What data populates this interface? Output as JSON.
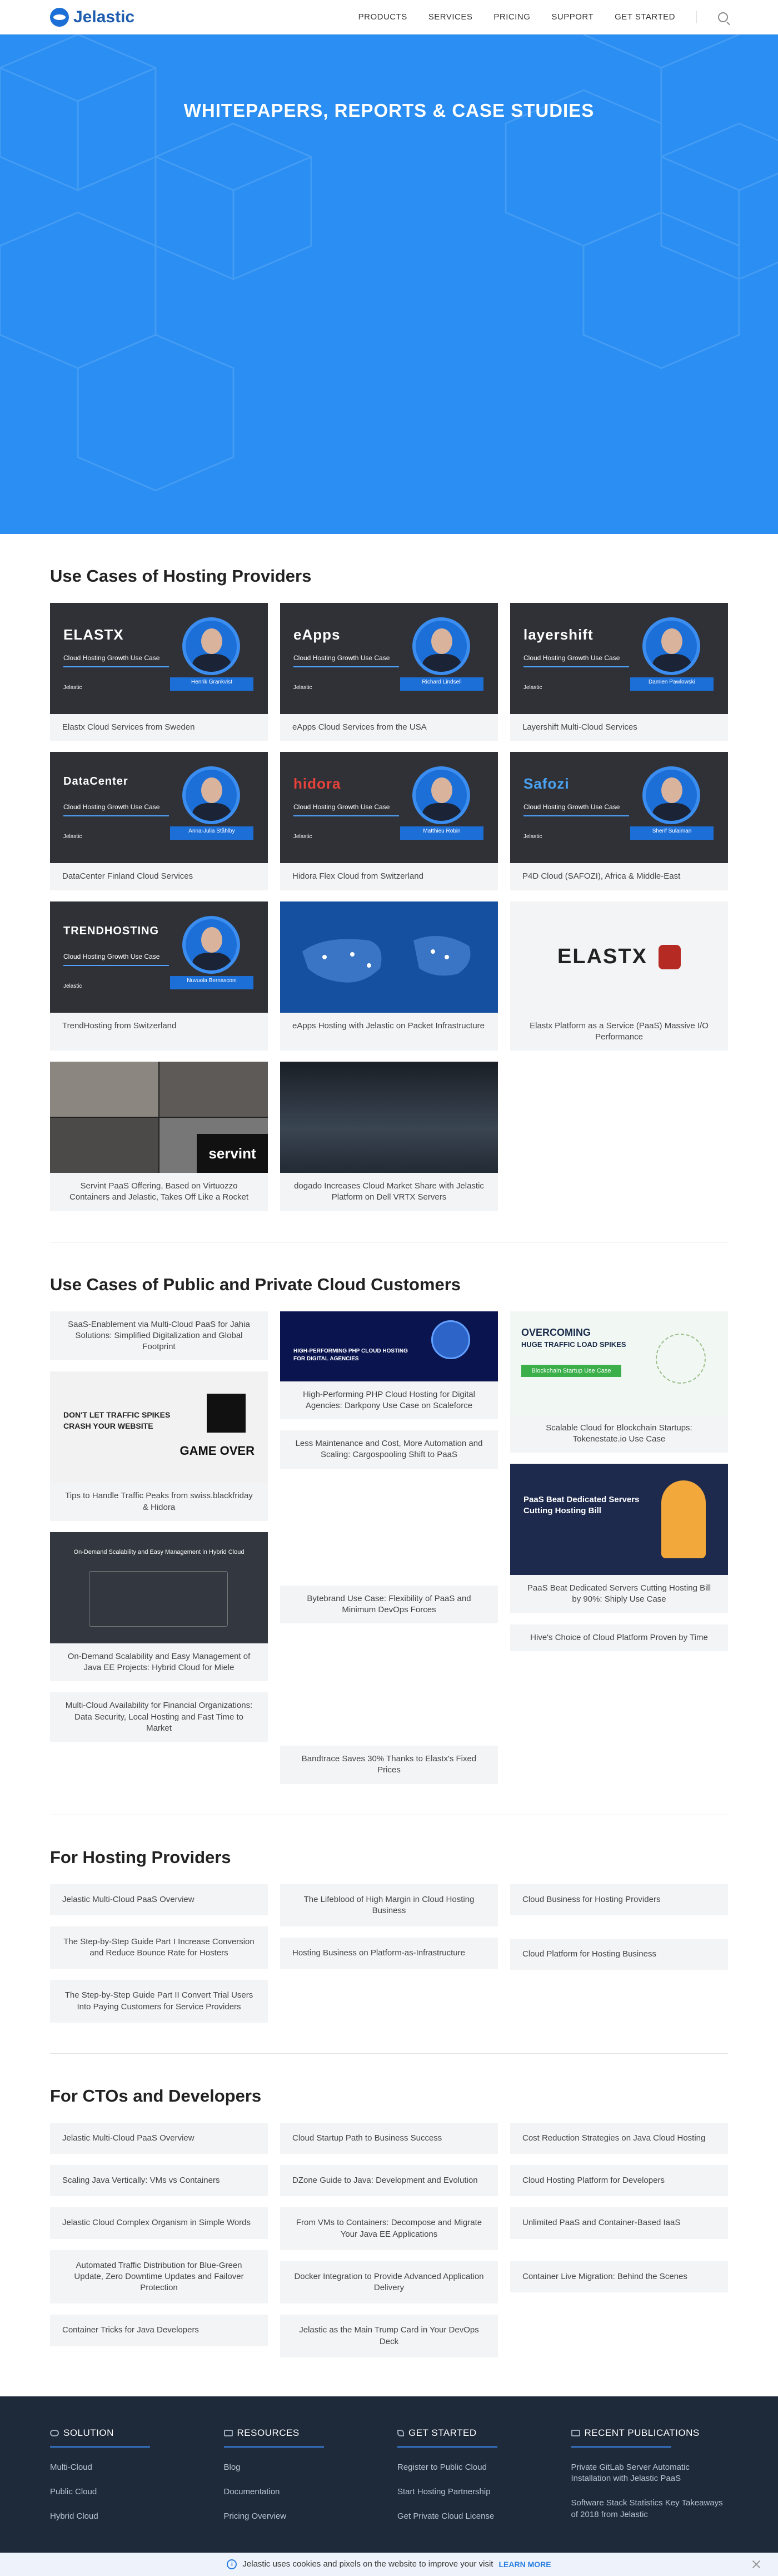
{
  "header": {
    "logo": "Jelastic",
    "nav": [
      "PRODUCTS",
      "SERVICES",
      "PRICING",
      "SUPPORT",
      "GET STARTED"
    ]
  },
  "hero": {
    "title": "WHITEPAPERS, REPORTS & CASE STUDIES"
  },
  "hosting_use_cases": {
    "title": "Use Cases of Hosting Providers",
    "cards": [
      {
        "caption": "Elastx Cloud Services from Sweden",
        "brand": "ELASTX",
        "growth": "Cloud Hosting Growth Use Case",
        "logo": "Jelastic",
        "person": "Henrik Grankvist"
      },
      {
        "caption": "eApps Cloud Services from the USA",
        "brand": "eApps",
        "growth": "Cloud Hosting Growth Use Case",
        "logo": "Jelastic",
        "person": "Richard Lindsell"
      },
      {
        "caption": "Layershift Multi-Cloud Services",
        "brand": "layershift",
        "growth": "Cloud Hosting Growth Use Case",
        "logo": "Jelastic",
        "person": "Damien Pawlowski"
      },
      {
        "caption": "DataCenter Finland Cloud Services",
        "brand": "DataCenter",
        "growth": "Cloud Hosting Growth Use Case",
        "logo": "Jelastic",
        "person": "Anna-Julia Ståhlby"
      },
      {
        "caption": "Hidora Flex Cloud from Switzerland",
        "brand": "hidora",
        "growth": "Cloud Hosting Growth Use Case",
        "logo": "Jelastic",
        "person": "Matthieu Robin"
      },
      {
        "caption": "P4D Cloud (SAFOZI), Africa & Middle-East",
        "brand": "Safozi",
        "growth": "Cloud Hosting Growth Use Case",
        "logo": "Jelastic",
        "person": "Sherif Sulaiman"
      },
      {
        "caption": "TrendHosting from Switzerland",
        "brand": "TRENDHOSTING",
        "growth": "Cloud Hosting Growth Use Case",
        "logo": "Jelastic",
        "person": "Nuvuola Bernasconi"
      },
      {
        "caption": "eApps Hosting with Jelastic on Packet Infrastructure"
      },
      {
        "caption": "Elastx Platform as a Service (PaaS) Massive I/O Performance",
        "brand": "ELASTX"
      },
      {
        "caption": "Servint PaaS Offering, Based on Virtuozzo Containers and Jelastic, Takes Off Like a Rocket",
        "brand": "servint"
      },
      {
        "caption": "dogado Increases Cloud Market Share with Jelastic Platform on Dell VRTX Servers"
      }
    ]
  },
  "cloud_use_cases": {
    "title": "Use Cases of Public and Private Cloud Customers",
    "col1": [
      {
        "caption": "SaaS-Enablement via Multi-Cloud PaaS for Jahia Solutions: Simplified Digitalization and Global Footprint"
      },
      {
        "caption": "Tips to Handle Traffic Peaks from swiss.blackfriday & Hidora",
        "promo1": "DON'T LET TRAFFIC SPIKES",
        "promo2": "CRASH YOUR WEBSITE",
        "promo3": "GAME OVER"
      },
      {
        "caption": "On-Demand Scalability and Easy Management of Java EE Projects: Hybrid Cloud for Miele",
        "promo1": "On-Demand Scalability and Easy Management in Hybrid Cloud"
      },
      {
        "caption": "Multi-Cloud Availability for Financial Organizations: Data Security, Local Hosting and Fast Time to Market"
      }
    ],
    "col2": [
      {
        "caption": "High-Performing PHP Cloud Hosting for Digital Agencies: Darkpony Use Case on Scaleforce",
        "promo1": "HIGH-PERFORMING PHP CLOUD HOSTING",
        "promo2": "FOR DIGITAL AGENCIES"
      },
      {
        "caption": "Less Maintenance and Cost, More Automation and Scaling: Cargospooling Shift to PaaS"
      },
      {
        "caption": "Bytebrand Use Case: Flexibility of PaaS and Minimum DevOps Forces"
      },
      {
        "caption": "Bandtrace Saves 30% Thanks to Elastx's Fixed Prices"
      }
    ],
    "col3": [
      {
        "caption": "Scalable Cloud for Blockchain Startups: Tokenestate.io Use Case",
        "promo1": "OVERCOMING",
        "promo2": "HUGE TRAFFIC LOAD SPIKES",
        "promo3": "Blockchain Startup Use Case"
      },
      {
        "caption": "PaaS Beat Dedicated Servers Cutting Hosting Bill by 90%: Shiply Use Case",
        "promo1": "PaaS Beat Dedicated Servers",
        "promo2": "Cutting Hosting Bill"
      },
      {
        "caption": "Hive's Choice of Cloud Platform Proven by Time"
      }
    ]
  },
  "hosting_providers": {
    "title": "For Hosting Providers",
    "col1": [
      "Jelastic Multi-Cloud PaaS Overview",
      "The Step-by-Step Guide Part I Increase Conversion and Reduce Bounce Rate for Hosters",
      "The Step-by-Step Guide Part II Convert Trial Users Into Paying Customers for Service Providers"
    ],
    "col2": [
      "The Lifeblood of High Margin in Cloud Hosting Business",
      "Hosting Business on Platform-as-Infrastructure"
    ],
    "col3": [
      "Cloud Business for Hosting Providers",
      "Cloud Platform for Hosting Business"
    ]
  },
  "ctos": {
    "title": "For CTOs and Developers",
    "col1": [
      "Jelastic Multi-Cloud PaaS Overview",
      "Scaling Java Vertically: VMs vs Containers",
      "Jelastic Cloud Complex Organism in Simple Words",
      "Automated Traffic Distribution for Blue-Green Update, Zero Downtime Updates and Failover Protection",
      "Container Tricks for Java Developers"
    ],
    "col2": [
      "Cloud Startup Path to Business Success",
      "DZone Guide to Java: Development and Evolution",
      "From VMs to Containers: Decompose and Migrate Your Java EE Applications",
      "Docker Integration to Provide Advanced Application Delivery",
      "Jelastic as the Main Trump Card in Your DevOps Deck"
    ],
    "col3": [
      "Cost Reduction Strategies on Java Cloud Hosting",
      "Cloud Hosting Platform for Developers",
      "Unlimited PaaS and Container-Based IaaS",
      "Container Live Migration: Behind the Scenes"
    ]
  },
  "footer": {
    "cols": [
      {
        "title": "SOLUTION",
        "links": [
          "Multi-Cloud",
          "Public Cloud",
          "Hybrid Cloud"
        ]
      },
      {
        "title": "RESOURCES",
        "links": [
          "Blog",
          "Documentation",
          "Pricing Overview"
        ]
      },
      {
        "title": "GET STARTED",
        "links": [
          "Register to Public Cloud",
          "Start Hosting Partnership",
          "Get Private Cloud License"
        ]
      },
      {
        "title": "RECENT PUBLICATIONS",
        "links": [
          "Private GitLab Server Automatic Installation with Jelastic PaaS",
          "Software Stack Statistics Key Takeaways of 2018 from Jelastic"
        ]
      }
    ],
    "cookie_text": "Jelastic uses cookies and pixels on the website to improve your visit",
    "cookie_link": "LEARN MORE"
  },
  "colors": {
    "brand": "#1d6fd8",
    "hero": "#2a8ef2",
    "footer": "#1e2a3a"
  }
}
